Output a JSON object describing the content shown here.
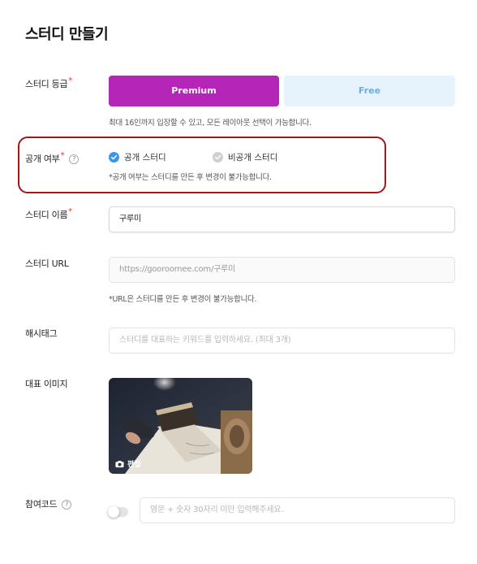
{
  "page": {
    "title": "스터디 만들기"
  },
  "tier": {
    "label": "스터디 등급",
    "premium_label": "Premium",
    "free_label": "Free",
    "hint": "최대 16인까지 입장할 수 있고, 모든 레이아웃 선택이 가능합니다.",
    "selected": "Premium"
  },
  "visibility": {
    "label": "공개 여부",
    "help": "?",
    "public_label": "공개 스터디",
    "private_label": "비공개 스터디",
    "selected": "공개 스터디",
    "hint": "*공개 여부는 스터디를 만든 후 변경이 불가능합니다."
  },
  "name": {
    "label": "스터디 이름",
    "value": "구루미"
  },
  "url": {
    "label": "스터디 URL",
    "value": "https://gooroomee.com/구루미",
    "hint": "*URL은 스터디를 만든 후 변경이 불가능합니다."
  },
  "hashtag": {
    "label": "해시태그",
    "placeholder": "스터디를 대표하는 키워드를 입력하세요. (최대 3개)"
  },
  "image": {
    "label": "대표 이미지",
    "edit_label": "편집"
  },
  "join_code": {
    "label": "참여코드",
    "help": "?",
    "enabled": false,
    "placeholder": "영문 + 숫자 30자리 미만 입력해주세요."
  },
  "colors": {
    "premium": "#b526b8",
    "free_bg": "#e6f3fc",
    "free_text": "#6eaee0",
    "radio_checked": "#3b97e6",
    "required": "#e53935",
    "highlight": "#a01818"
  }
}
